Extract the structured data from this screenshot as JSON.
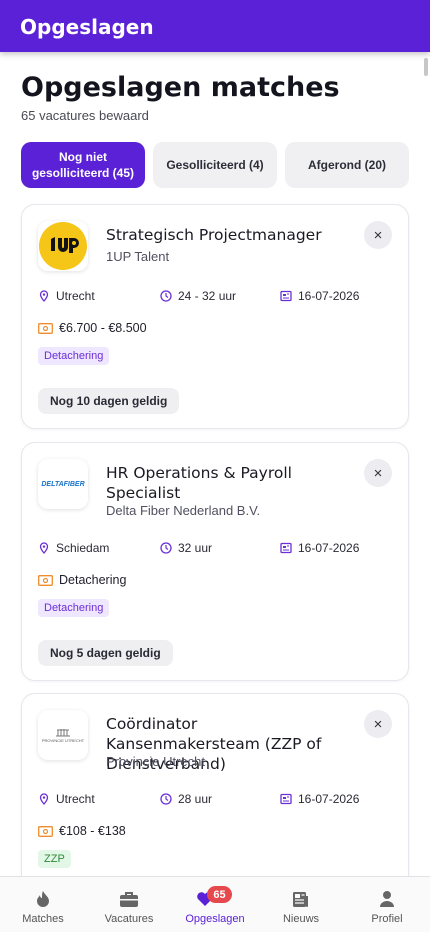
{
  "appbar": {
    "title": "Opgeslagen"
  },
  "page": {
    "title": "Opgeslagen matches",
    "subtitle": "65 vacatures bewaard"
  },
  "tabs": [
    {
      "label": "Nog niet gesolliciteerd (45)",
      "active": true
    },
    {
      "label": "Gesolliciteerd (4)",
      "active": false
    },
    {
      "label": "Afgerond (20)",
      "active": false
    }
  ],
  "jobs": [
    {
      "title": "Strategisch Projectmanager",
      "company": "1UP Talent",
      "location": "Utrecht",
      "hours": "24 - 32 uur",
      "date": "16-07-2026",
      "salary": "€6.700 - €8.500",
      "badge": "Detachering",
      "validity": "Nog 10 dagen geldig",
      "logo_icon": "1up-logo"
    },
    {
      "title": "HR Operations & Payroll Specialist",
      "company": "Delta Fiber Nederland B.V.",
      "location": "Schiedam",
      "hours": "32 uur",
      "date": "16-07-2026",
      "salary": "Detachering",
      "badge": "Detachering",
      "validity": "Nog 5 dagen geldig",
      "logo_text": "DELTAFIBER",
      "logo_icon": "deltafiber-logo"
    },
    {
      "title": "Coördinator Kansenmakersteam (ZZP of Dienstverband)",
      "company": "Provincie Utrecht",
      "location": "Utrecht",
      "hours": "28 uur",
      "date": "16-07-2026",
      "salary": "€108 - €138",
      "badge": "ZZP",
      "logo_text": "PROVINCIE UTRECHT",
      "logo_icon": "provincie-utrecht-logo"
    }
  ],
  "nav": [
    {
      "label": "Matches",
      "icon": "flame-icon"
    },
    {
      "label": "Vacatures",
      "icon": "briefcase-icon"
    },
    {
      "label": "Opgeslagen",
      "icon": "heart-icon",
      "badge": "65",
      "active": true
    },
    {
      "label": "Nieuws",
      "icon": "newspaper-icon"
    },
    {
      "label": "Profiel",
      "icon": "person-icon"
    }
  ],
  "colors": {
    "primary": "#5b21d6",
    "badge_bg": "#efe6ff",
    "nav_badge": "#e5484d"
  }
}
